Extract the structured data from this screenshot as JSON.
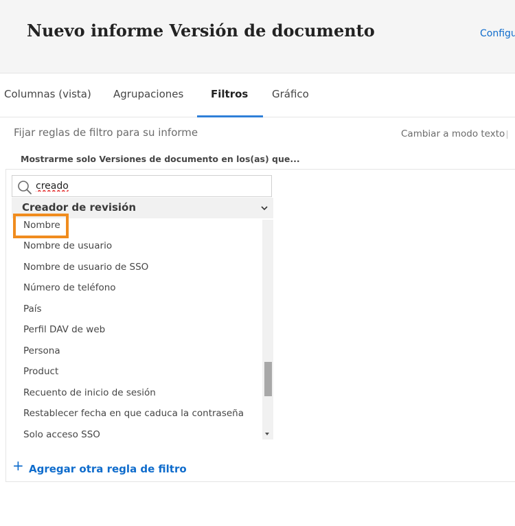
{
  "header": {
    "title": "Nuevo informe Versión de documento",
    "configure_link": "Configur"
  },
  "tabs": [
    {
      "label": "Columnas (vista)",
      "active": false
    },
    {
      "label": "Agrupaciones",
      "active": false
    },
    {
      "label": "Filtros",
      "active": true
    },
    {
      "label": "Gráfico",
      "active": false
    }
  ],
  "filters": {
    "subtitle": "Fijar reglas de filtro para su informe",
    "text_mode_link": "Cambiar a modo texto",
    "rule_title": "Mostrarme solo Versiones de documento en los(as) que...",
    "search": {
      "value": "creado"
    },
    "group_label": "Creador de revisión",
    "options": [
      "Nombre",
      "Nombre de usuario",
      "Nombre de usuario de SSO",
      "Número de teléfono",
      "País",
      "Perfil DAV de web",
      "Persona",
      "Product",
      "Recuento de inicio de sesión",
      "Restablecer fecha en que caduca la contraseña",
      "Solo acceso SSO"
    ],
    "highlighted_option": "Nombre",
    "add_rule_label": "Agregar otra regla de filtro"
  },
  "colors": {
    "accent": "#0f6ccc",
    "tab_underline": "#2f7fd8",
    "highlight_border": "#f08c1e"
  }
}
